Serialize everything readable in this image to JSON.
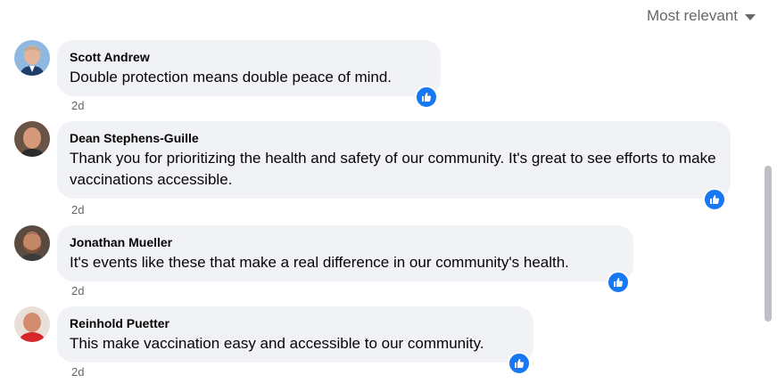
{
  "sort": {
    "label": "Most relevant",
    "icon": "caret-down-icon"
  },
  "comments": [
    {
      "author": "Scott Andrew",
      "text": "Double protection means double peace of mind.",
      "time": "2d",
      "reaction": "like-icon"
    },
    {
      "author": "Dean Stephens-Guille",
      "text": "Thank you for prioritizing the health and safety of our community. It's great to see efforts to make vaccinations accessible.",
      "time": "2d",
      "reaction": "like-icon"
    },
    {
      "author": "Jonathan Mueller",
      "text": "It's events like these that make a real difference in our community's health.",
      "time": "2d",
      "reaction": "like-icon"
    },
    {
      "author": "Reinhold Puetter",
      "text": "This make vaccination easy and accessible to our community.",
      "time": "2d",
      "reaction": "like-icon"
    }
  ],
  "colors": {
    "bubble": "#f0f2f5",
    "like": "#1877f2",
    "secondary_text": "#65676b"
  }
}
